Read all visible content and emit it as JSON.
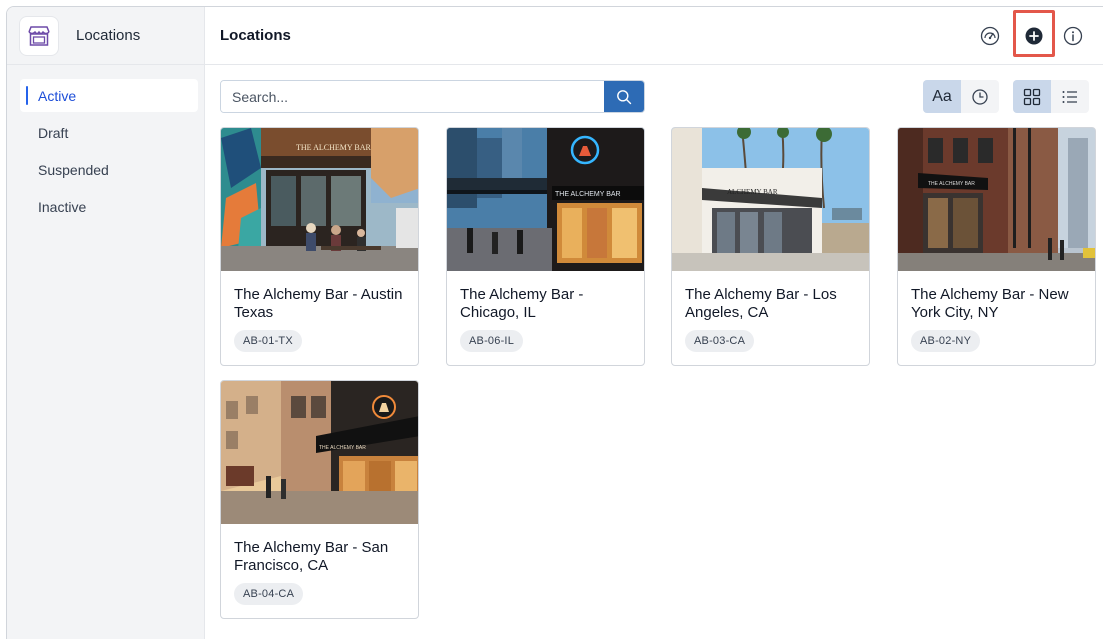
{
  "sidebar": {
    "title": "Locations",
    "items": [
      {
        "label": "Active",
        "active": true
      },
      {
        "label": "Draft"
      },
      {
        "label": "Suspended"
      },
      {
        "label": "Inactive"
      }
    ]
  },
  "header": {
    "title": "Locations"
  },
  "search": {
    "placeholder": "Search..."
  },
  "toolbar": {
    "sort_alpha_label": "Aa"
  },
  "colors": {
    "accent": "#2d6bb5",
    "highlight": "#e3574a",
    "segment_active": "#c9d7ea"
  },
  "locations": [
    {
      "name": "The Alchemy Bar - Austin Texas",
      "code": "AB-01-TX",
      "image_text": "THE ALCHEMY BAR"
    },
    {
      "name": "The Alchemy Bar - Chicago, IL",
      "code": "AB-06-IL",
      "image_text": "THE ALCHEMY BAR"
    },
    {
      "name": "The Alchemy Bar - Los Angeles, CA",
      "code": "AB-03-CA",
      "image_text": "ALCHEMY BAR"
    },
    {
      "name": "The Alchemy Bar - New York City, NY",
      "code": "AB-02-NY",
      "image_text": "THE ALCHEMY BAR"
    },
    {
      "name": "The Alchemy Bar - San Francisco, CA",
      "code": "AB-04-CA",
      "image_text": "THE ALCHEMY BAR"
    }
  ]
}
